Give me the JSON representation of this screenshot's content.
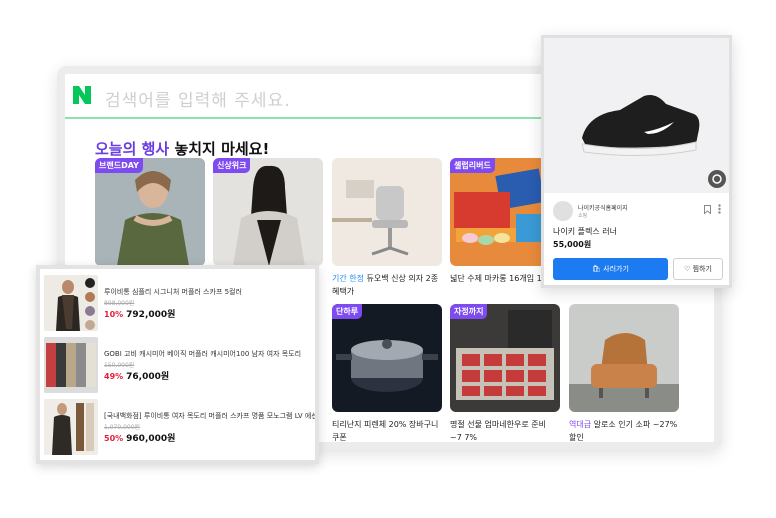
{
  "search": {
    "placeholder": "검색어를 입력해 주세요."
  },
  "headline": {
    "accent": "오늘의 행사",
    "rest": " 놓치지 마세요!"
  },
  "cards": [
    {
      "badge": "브랜드DAY",
      "text": ""
    },
    {
      "badge": "신상위크",
      "text": ""
    },
    {
      "badge": "",
      "kw": "기간 한정",
      "text": " 듀오백 신상 의자 2종 혜택가"
    },
    {
      "badge": "셀럽리버드",
      "text": "넓단 수제 마카롱 16개입 1"
    },
    {
      "badge": "단하루",
      "text": "티리난지 피렌체 20% 장바구니 쿠폰"
    },
    {
      "badge": "자정까지",
      "text": "명절 선물 엄마네한우로 준비 ~7 7%"
    },
    {
      "badge": "",
      "kw": "역대급",
      "text": " 알로소 인기 소파 ~27% 할인"
    }
  ],
  "list": [
    {
      "name": "루이비통 심플리 시그니처 머플러 스카프 5컬러",
      "orig": "898,000원",
      "pct": "10%",
      "price": "792,000원"
    },
    {
      "name": "GOBI 고비 캐시미어 베이직 머플러 캐시미어100 남자 여자 목도리",
      "orig": "150,000원",
      "pct": "49%",
      "price": "76,000원"
    },
    {
      "name": "[국내백화점] 루이비통 여자 목도리 머플러 스카프 명품 모노그램 LV 에센",
      "orig": "1,070,000원",
      "pct": "50%",
      "price": "960,000원"
    }
  ],
  "shoe": {
    "seller": "나이키공식홈페이지",
    "seller_sub": "쇼핑",
    "name": "나이키 플렉스 러너",
    "price": "55,000원",
    "buy_label": "사러가기",
    "wish_label": "찜하기"
  },
  "colors": {
    "accent": "#7d4bf0",
    "brand_green": "#03c75a",
    "buy_blue": "#1d7bf2",
    "discount_red": "#e51e3c"
  }
}
